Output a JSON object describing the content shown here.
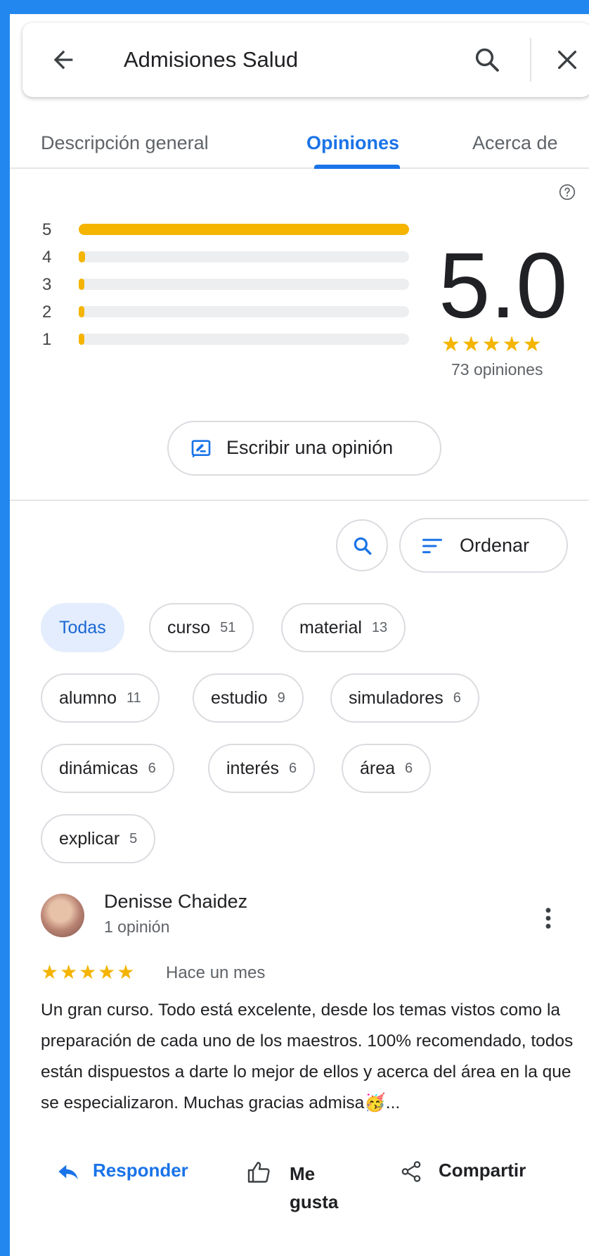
{
  "search_bar": {
    "title": "Admisiones Salud",
    "icons": [
      "back-arrow-icon",
      "search-icon",
      "close-icon"
    ]
  },
  "tabs": [
    {
      "label": "Descripción general",
      "active": false
    },
    {
      "label": "Opiniones",
      "active": true
    },
    {
      "label": "Acerca de",
      "active": false
    }
  ],
  "rating": {
    "score": "5.0",
    "stars": "★★★★★",
    "count_label": "73 opiniones",
    "distribution": [
      {
        "label": "5",
        "fraction": 1.0
      },
      {
        "label": "4",
        "fraction": 0.02
      },
      {
        "label": "3",
        "fraction": 0.005
      },
      {
        "label": "2",
        "fraction": 0.005
      },
      {
        "label": "1",
        "fraction": 0.005
      }
    ]
  },
  "write_review_label": "Escribir una opinión",
  "sort_label": "Ordenar",
  "chips": [
    {
      "label": "Todas",
      "count": "",
      "active": true
    },
    {
      "label": "curso",
      "count": "51"
    },
    {
      "label": "material",
      "count": "13"
    },
    {
      "label": "alumno",
      "count": "11"
    },
    {
      "label": "estudio",
      "count": "9"
    },
    {
      "label": "simuladores",
      "count": "6"
    },
    {
      "label": "dinámicas",
      "count": "6"
    },
    {
      "label": "interés",
      "count": "6"
    },
    {
      "label": "área",
      "count": "6"
    },
    {
      "label": "explicar",
      "count": "5"
    }
  ],
  "review": {
    "name": "Denisse Chaidez",
    "meta": "1 opinión",
    "stars": "★★★★★",
    "date": "Hace un mes",
    "text": "Un gran curso. Todo está excelente, desde los temas vistos como la preparación de cada uno de los maestros. 100% recomendado, todos están dispuestos a darte lo mejor de ellos y acerca del área en la que se especializaron. Muchas gracias admisa🥳..."
  },
  "actions": {
    "reply": "Responder",
    "like": "Me gusta",
    "share": "Compartir"
  },
  "colors": {
    "accent": "#1a73e8",
    "star": "#f4b400",
    "frame_border": "#2387f0"
  }
}
